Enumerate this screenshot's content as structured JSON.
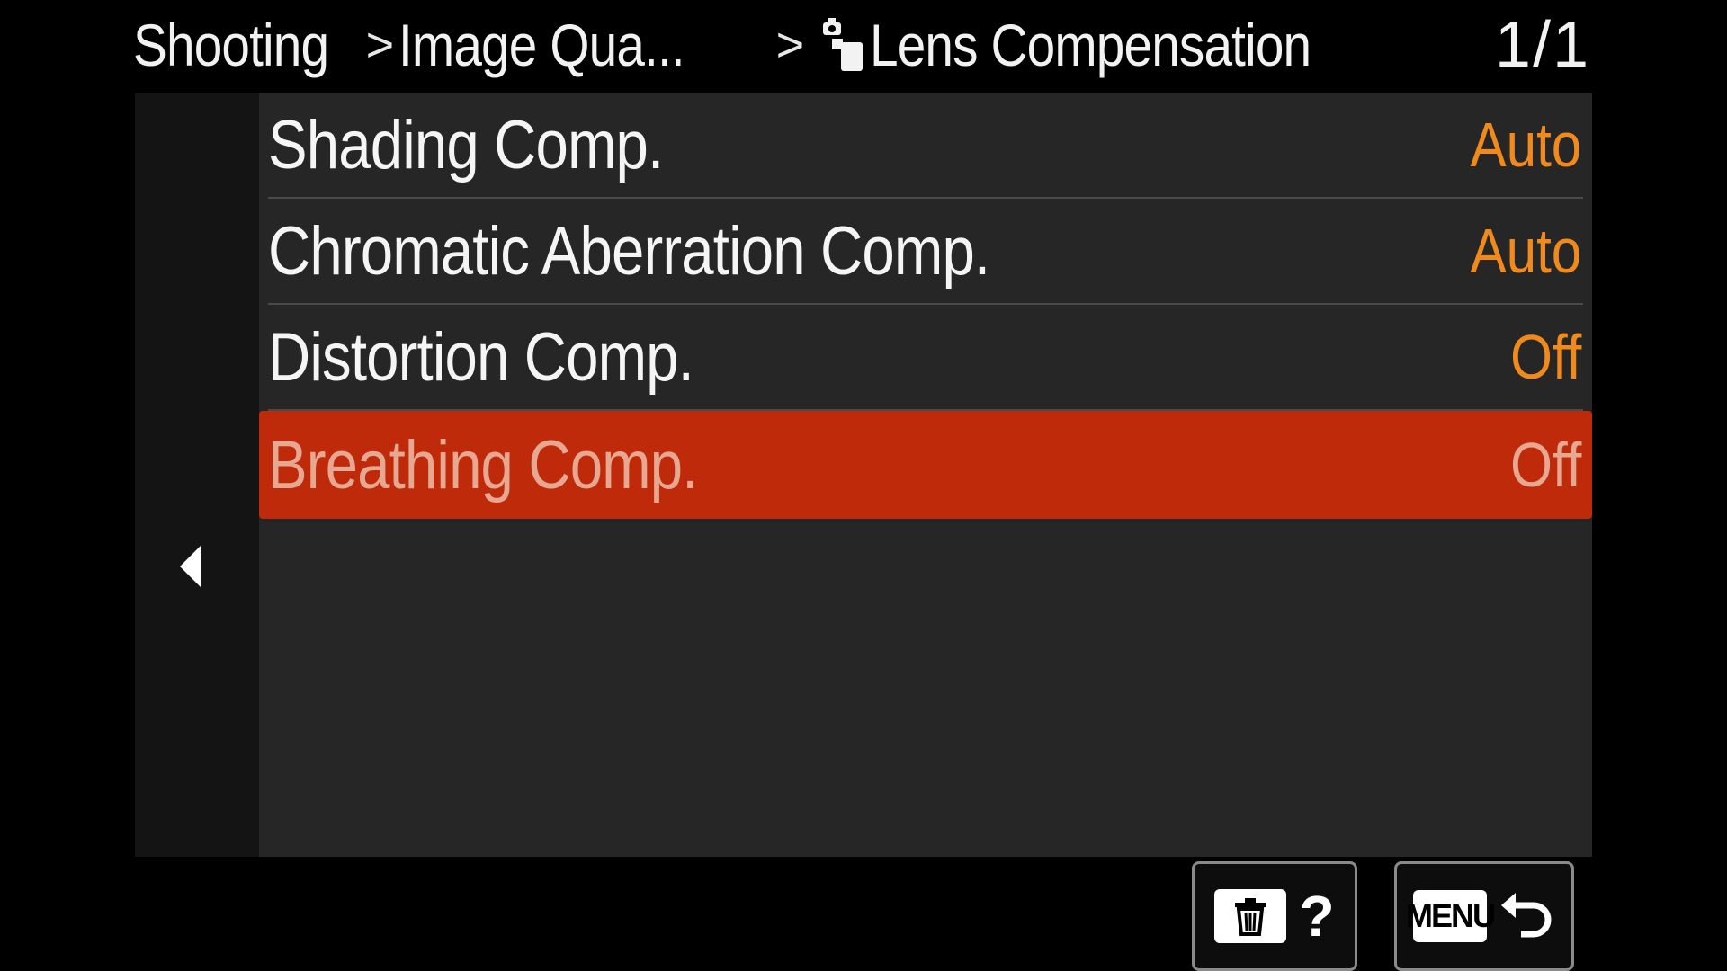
{
  "header": {
    "breadcrumb": [
      {
        "label": "Shooting"
      },
      {
        "label": "Image Qua..."
      },
      {
        "label": "Lens Compensation"
      }
    ],
    "separator": ">",
    "page_indicator": "1/1"
  },
  "menu": {
    "items": [
      {
        "label": "Shading Comp.",
        "value": "Auto",
        "selected": false
      },
      {
        "label": "Chromatic Aberration Comp.",
        "value": "Auto",
        "selected": false
      },
      {
        "label": "Distortion Comp.",
        "value": "Off",
        "selected": false
      },
      {
        "label": "Breathing Comp.",
        "value": "Off",
        "selected": true
      }
    ]
  },
  "buttons": {
    "delete_help": {
      "icons": [
        "trash-icon",
        "help-icon"
      ],
      "help_label": "?"
    },
    "menu_back": {
      "key_label": "MENU",
      "icons": [
        "return-arrow-icon"
      ]
    }
  },
  "colors": {
    "value_accent": "#f08a1c",
    "selected_row": "#bf2a0a",
    "panel": "#262626",
    "rail": "#141414"
  }
}
